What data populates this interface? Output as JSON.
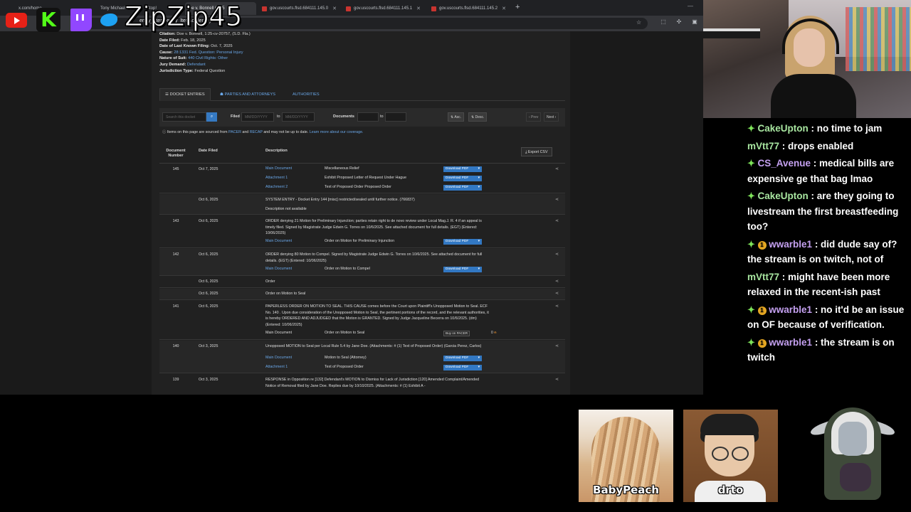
{
  "browser": {
    "tabs": [
      {
        "label": "x.com/home"
      },
      {
        "label": "Tony Michael"
      },
      {
        "label": "Stop!"
      },
      {
        "label": "oe v. Bonnell (1:25"
      },
      {
        "label": "gov.uscourts.flsd.684111.145.0"
      },
      {
        "label": "gov.uscourts.flsd.684111.145.1"
      },
      {
        "label": "gov.uscourts.flsd.684111.145.2"
      }
    ],
    "url": "entry_gte=&entry_lte=&order_by=desc"
  },
  "case_meta": {
    "citation_label": "Citation:",
    "citation": "Doe v. Bonnell, 1:25-cv-20757, (S.D. Fla.)",
    "date_filed_label": "Date Filed:",
    "date_filed": "Feb. 18, 2025",
    "last_filing_label": "Date of Last Known Filing:",
    "last_filing": "Oct. 7, 2025",
    "cause_label": "Cause:",
    "cause": "28:1331 Fed. Question: Personal Injury",
    "nature_label": "Nature of Suit:",
    "nature": "440 Civil Rights: Other",
    "jury_label": "Jury Demand:",
    "jury": "Defendant",
    "jurisdiction_label": "Jurisdiction Type:",
    "jurisdiction": "Federal Question"
  },
  "docket_tabs": [
    "DOCKET ENTRIES",
    "PARTIES AND ATTORNEYS",
    "AUTHORITIES"
  ],
  "filters": {
    "search_placeholder": "Search this docket",
    "filed_label": "Filed",
    "date_placeholder": "MM/DD/YYYY",
    "to_label": "to",
    "documents_label": "Documents",
    "asc_label": "Asc.",
    "desc_label": "Desc.",
    "prev_label": "‹ Prev",
    "next_label": "Next ›"
  },
  "notice": {
    "text_1": "Items on this page are sourced from ",
    "pacer": "PACER",
    "and": " and ",
    "recap": "RECAP",
    "text_2": " and may not be up to date. ",
    "learn": "Learn more about our coverage."
  },
  "table": {
    "col_number": "Document Number",
    "col_date": "Date Filed",
    "col_description": "Description",
    "export_label": "Export CSV",
    "download_label": "Download PDF",
    "buy_label": "Buy on PACER",
    "entries": [
      {
        "number": "145",
        "date": "Oct 7, 2025",
        "description": "",
        "attachments": [
          {
            "name": "Main Document",
            "desc": "Miscellaneous Relief"
          },
          {
            "name": "Attachment 1",
            "desc": "Exhibit Proposed Letter of Request Under Hague"
          },
          {
            "name": "Attachment 2",
            "desc": "Text of Proposed Order Proposed Order"
          }
        ]
      },
      {
        "number": "",
        "date": "Oct 6, 2025",
        "description": "SYSTEM ENTRY - Docket Entry 144 [misc] restricted/sealed until further notice. (766837)",
        "note": "Description not available"
      },
      {
        "number": "143",
        "date": "Oct 6, 2025",
        "description": "ORDER denying 21 Motion for Preliminary Injunction; parties retain right to de novo review under Local Mag.J. R. 4 if an appeal is timely filed. Signed by Magistrate Judge Edwin G. Torres on 10/6/2025. See attached document for full details. (EGT) (Entered: 10/06/2025)",
        "attachments": [
          {
            "name": "Main Document",
            "desc": "Order on Motion for Preliminary Injunction"
          }
        ]
      },
      {
        "number": "142",
        "date": "Oct 6, 2025",
        "description": "ORDER denying 80 Motion to Compel. Signed by Magistrate Judge Edwin G. Torres on 10/6/2025. See attached document for full details. (EGT) (Entered: 10/06/2025)",
        "attachments": [
          {
            "name": "Main Document",
            "desc": "Order on Motion to Compel"
          }
        ]
      },
      {
        "number": "",
        "date": "Oct 6, 2025",
        "description": "Order"
      },
      {
        "number": "",
        "date": "Oct 6, 2025",
        "description": "Order on Motion to Seal"
      },
      {
        "number": "141",
        "date": "Oct 6, 2025",
        "description": "PAPERLESS ORDER ON MOTION TO SEAL. THIS CAUSE comes before the Court upon Plaintiff's Unopposed Motion to Seal. ECF No. 140 . Upon due consideration of the Unopposed Motion to Seal, the pertinent portions of the record, and the relevant authorities, it is hereby ORDERED AND ADJUDGED that the Motion is GRANTED. Signed by Judge Jacqueline Becerra on 10/6/2025. (dm) (Entered: 10/06/2025)",
        "attachments": [
          {
            "name": "Main Document",
            "desc": "Order on Motion to Seal",
            "buy": true,
            "count": "0"
          }
        ]
      },
      {
        "number": "140",
        "date": "Oct 3, 2025",
        "description": "Unopposed MOTION to Seal per Local Rule 5.4 by Jane Doe. (Attachments: # (1) Text of Proposed Order) (Garcia Perez, Carlos)",
        "attachments": [
          {
            "name": "Main Document",
            "desc": "Motion to Seal (Attorney)"
          },
          {
            "name": "Attachment 1",
            "desc": "Text of Proposed Order"
          }
        ]
      },
      {
        "number": "139",
        "date": "Oct 3, 2025",
        "description": "RESPONSE in Opposition re [132] Defendant's MOTION to Dismiss for Lack of Jurisdiction [120] Amended Complaint/Amended Notice of Removal filed by Jane Doe. Replies due by 10/10/2025. (Attachments: # (1) Exhibit A -"
      }
    ]
  },
  "overlay": {
    "handle": "ZipZip45",
    "icons": [
      "youtube-icon",
      "kick-icon",
      "twitch-icon",
      "twitter-icon"
    ]
  },
  "chat": [
    {
      "user": "CakeUpton",
      "color": "green",
      "badge": false,
      "text": " : no time to jam"
    },
    {
      "user": "mVtt77",
      "color": "green",
      "badge": false,
      "nodia": true,
      "text": " : drops enabled"
    },
    {
      "user": "CS_Avenue",
      "color": "purple",
      "badge": false,
      "text": " : medical bills are expensive ge that bag lmao"
    },
    {
      "user": "CakeUpton",
      "color": "green",
      "badge": false,
      "text": " : are they going to livestream the first breastfeeding too?"
    },
    {
      "user": "wwarble1",
      "color": "purple",
      "badge": true,
      "text": " : did dude say of? the stream is on twitch, not of"
    },
    {
      "user": "mVtt77",
      "color": "green",
      "badge": false,
      "nodia": true,
      "text": " : might have been more relaxed in the recent-ish past"
    },
    {
      "user": "wwarble1",
      "color": "purple",
      "badge": true,
      "text": " : no it'd be an issue on OF because of verification."
    },
    {
      "user": "wwarble1",
      "color": "purple",
      "badge": true,
      "text": " : the stream is on twitch"
    }
  ],
  "participants": [
    "BabyPeach",
    "drto"
  ]
}
